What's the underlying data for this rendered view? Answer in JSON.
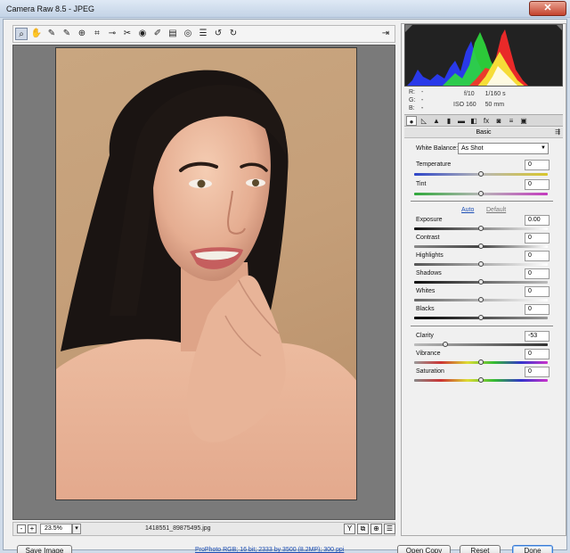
{
  "window": {
    "title": "Camera Raw 8.5  -  JPEG",
    "close_label": "✕"
  },
  "toolbar": {
    "tools": [
      "zoom-tool-icon",
      "hand-tool-icon",
      "white-balance-tool-icon",
      "color-sampler-tool-icon",
      "targeted-adjustment-tool-icon",
      "crop-tool-icon",
      "straighten-tool-icon",
      "spot-removal-tool-icon",
      "red-eye-removal-tool-icon",
      "adjustment-brush-icon",
      "graduated-filter-icon",
      "radial-filter-icon",
      "preferences-icon",
      "rotate-ccw-icon",
      "rotate-cw-icon"
    ],
    "tool_glyphs": [
      "⌕",
      "✋",
      "✎",
      "✎",
      "⊕",
      "⌗",
      "⊸",
      "✂",
      "◉",
      "✐",
      "▤",
      "◎",
      "☰",
      "↺",
      "↻"
    ],
    "fullscreen_glyph": "⇥"
  },
  "status": {
    "zoom_minus": "-",
    "zoom_plus": "+",
    "zoom_value": "23.5%",
    "zoom_drop": "▾",
    "filename": "1418551_89875495.jpg",
    "view_glyphs": [
      "Y",
      "⧉",
      "⊕",
      "☰"
    ]
  },
  "info": {
    "r_label": "R:",
    "r_value": "---",
    "g_label": "G:",
    "g_value": "---",
    "b_label": "B:",
    "b_value": "---",
    "aperture": "f/10",
    "shutter": "1/160 s",
    "iso": "ISO 160",
    "focal": "50 mm"
  },
  "tabs": [
    "●",
    "◺",
    "▲",
    "▮",
    "▬",
    "◧",
    "fx",
    "◙",
    "≡",
    "▣"
  ],
  "section": {
    "title": "Basic",
    "menu": "⇶"
  },
  "basic": {
    "white_balance_label": "White Balance:",
    "white_balance_value": "As Shot",
    "auto_label": "Auto",
    "default_label": "Default",
    "sliders": [
      {
        "label": "Temperature",
        "value": "0",
        "pos": 0.5
      },
      {
        "label": "Tint",
        "value": "0",
        "pos": 0.5
      },
      {
        "label": "Exposure",
        "value": "0.00",
        "pos": 0.5
      },
      {
        "label": "Contrast",
        "value": "0",
        "pos": 0.5
      },
      {
        "label": "Highlights",
        "value": "0",
        "pos": 0.5
      },
      {
        "label": "Shadows",
        "value": "0",
        "pos": 0.5
      },
      {
        "label": "Whites",
        "value": "0",
        "pos": 0.5
      },
      {
        "label": "Blacks",
        "value": "0",
        "pos": 0.5
      },
      {
        "label": "Clarity",
        "value": "-53",
        "pos": 0.235
      },
      {
        "label": "Vibrance",
        "value": "0",
        "pos": 0.5
      },
      {
        "label": "Saturation",
        "value": "0",
        "pos": 0.5
      }
    ]
  },
  "buttons": {
    "save": "Save Image",
    "workflow": "ProPhoto RGB; 16 bit; 2333 by 3500 (8.2MP); 300 ppi",
    "open": "Open Copy",
    "reset": "Reset",
    "done": "Done"
  }
}
